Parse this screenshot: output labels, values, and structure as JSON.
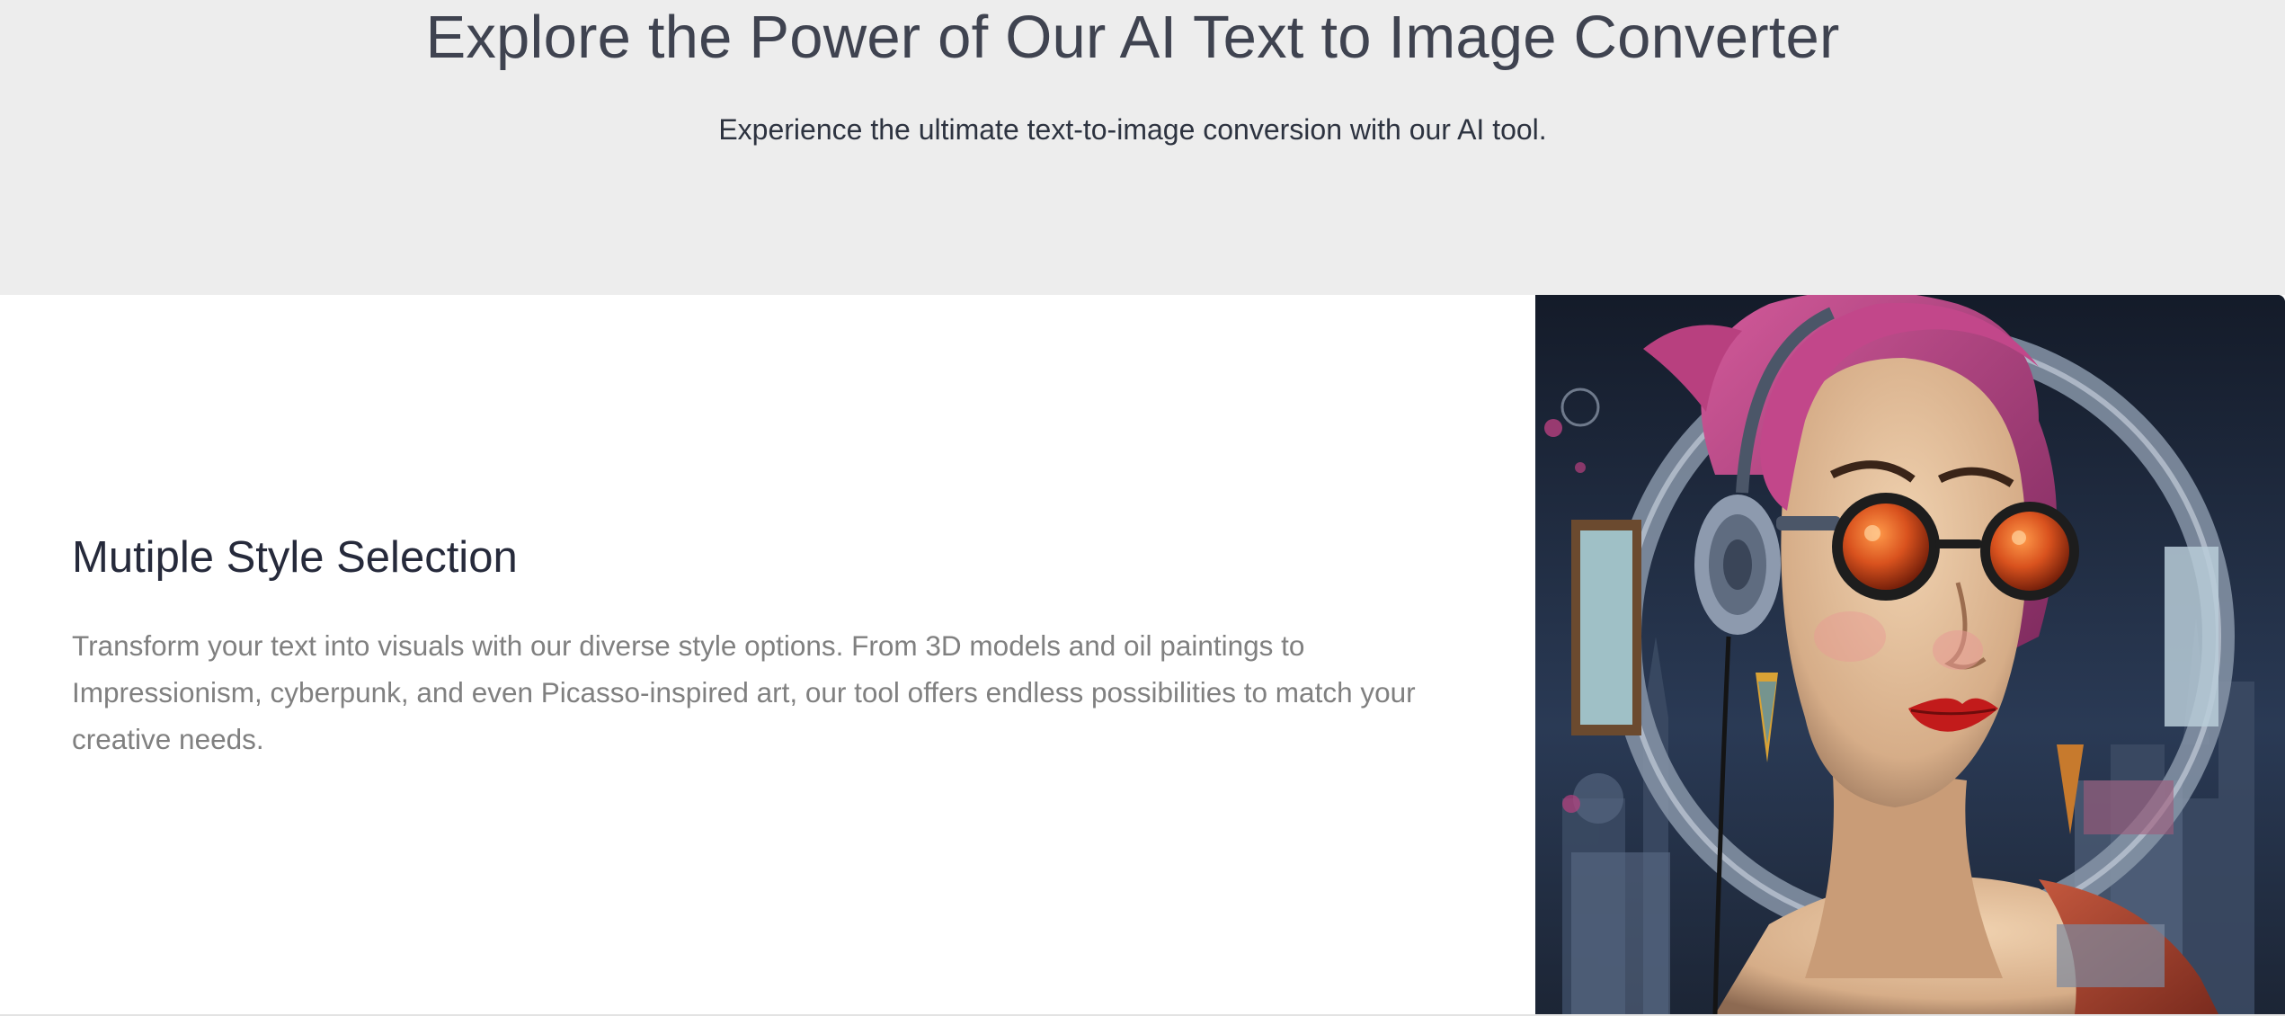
{
  "hero": {
    "title": "Explore the Power of Our AI Text to Image Converter",
    "subtitle": "Experience the ultimate text-to-image conversion with our AI tool."
  },
  "feature": {
    "title": "Mutiple Style Selection",
    "description": "Transform your text into visuals with our diverse style options. From 3D models and oil paintings to Impressionism, cyberpunk, and even Picasso-inspired art, our tool offers endless possibilities to match your creative needs."
  },
  "colors": {
    "hero_bg": "#ededed",
    "title_text": "#3f4350",
    "body_text": "#808080",
    "hair": "#b8407f",
    "lens": "#d9521e",
    "lips": "#c21b1b"
  }
}
